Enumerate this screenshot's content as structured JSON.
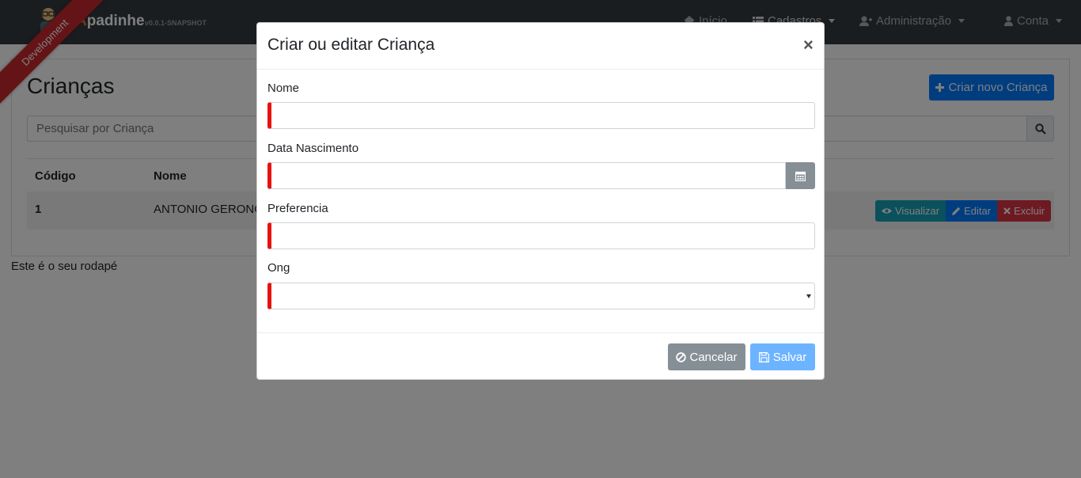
{
  "navbar": {
    "brand_first": "A",
    "brand_rest": "padinhe",
    "version": "v0.0.1-SNAPSHOT",
    "ribbon": "Development",
    "items": [
      {
        "label": "Início",
        "icon": "home-icon"
      },
      {
        "label": "Cadastros",
        "icon": "list-icon"
      },
      {
        "label": "Administração",
        "icon": "user-plus-icon"
      },
      {
        "label": "Conta",
        "icon": "user-icon"
      }
    ]
  },
  "page": {
    "title": "Crianças",
    "create_button": "Criar novo Criança",
    "search_placeholder": "Pesquisar por Criança",
    "table": {
      "headers": [
        "Código",
        "Nome"
      ],
      "rows": [
        {
          "code": "1",
          "name": "ANTONIO GERONC"
        }
      ],
      "actions": {
        "view": "Visualizar",
        "edit": "Editar",
        "delete": "Excluir"
      }
    },
    "footer": "Este é o seu rodapé"
  },
  "modal": {
    "title": "Criar ou editar Criança",
    "close": "×",
    "fields": {
      "nome": {
        "label": "Nome",
        "value": ""
      },
      "data_nascimento": {
        "label": "Data Nascimento",
        "value": ""
      },
      "preferencia": {
        "label": "Preferencia",
        "value": ""
      },
      "ong": {
        "label": "Ong",
        "value": ""
      }
    },
    "cancel_button": "Cancelar",
    "save_button": "Salvar"
  },
  "colors": {
    "navbar": "#343a40",
    "primary": "#007bff",
    "info": "#17a2b8",
    "danger": "#dc3545",
    "invalid_border": "#e8120f",
    "secondary": "#868e96"
  }
}
